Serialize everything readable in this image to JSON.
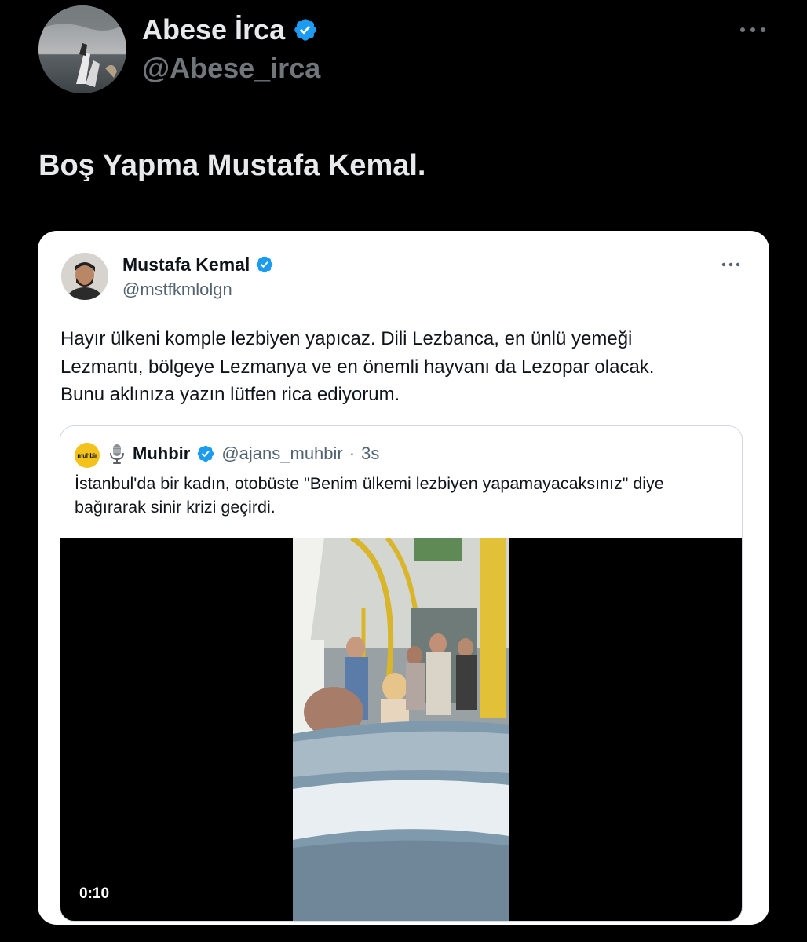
{
  "tweet": {
    "author": {
      "name": "Abese İrca",
      "handle": "@Abese_irca",
      "verified": true,
      "avatar_icon": "avatar-photo-icon"
    },
    "text": "Boş Yapma Mustafa Kemal.",
    "more_icon": "more-horizontal-icon"
  },
  "quoted": {
    "author": {
      "name": "Mustafa Kemal",
      "handle": "@mstfkmlolgn",
      "verified": true,
      "avatar_icon": "avatar-photo-icon"
    },
    "lines": [
      "Hayır ülkeni komple lezbiyen yapıcaz. Dili Lezbanca, en ünlü yemeği",
      "Lezmantı, bölgeye Lezmanya ve en önemli hayvanı da Lezopar olacak.",
      "Bunu aklınıza yazın lütfen rica ediyorum."
    ],
    "more_icon": "more-horizontal-icon",
    "nested": {
      "logo_text": "muhbir",
      "name": "Muhbir",
      "handle": "@ajans_muhbir",
      "separator": "·",
      "time": "3s",
      "verified": true,
      "lines": [
        "İstanbul'da bir kadın, otobüste \"Benim ülkemi lezbiyen yapamayacaksınız\" diye",
        "bağırarak sinir krizi geçirdi."
      ],
      "video": {
        "duration": "0:10"
      }
    }
  },
  "colors": {
    "background": "#000000",
    "verified_badge": "#1d9bf0",
    "card_background": "#ffffff",
    "text_primary_dark": "#e7e9ea",
    "text_secondary": "#71767b"
  }
}
